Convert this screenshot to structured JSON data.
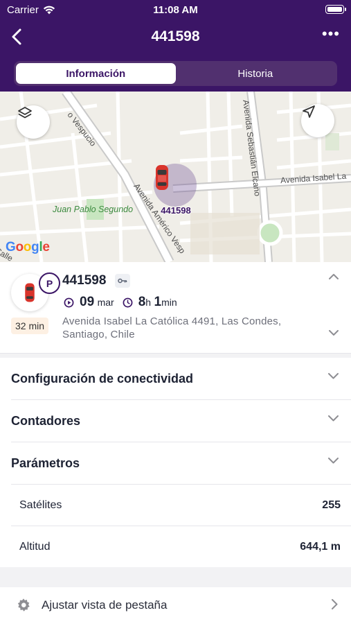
{
  "status_bar": {
    "carrier": "Carrier",
    "time": "11:08 AM",
    "battery_level": 1.0
  },
  "nav": {
    "title": "441598",
    "back_icon": "chevron-left-icon",
    "more_icon": "ellipsis-icon"
  },
  "tabs": [
    {
      "label": "Información",
      "active": true
    },
    {
      "label": "Historia",
      "active": false
    }
  ],
  "map": {
    "roads": {
      "vespucio_top": "o Vespucio",
      "vespucio_mid": "Avenida Américo Vesp",
      "sebastian": "Avenida Sebastián Elcano",
      "isabel": "Avenida Isabel La",
      "calle": "Calle"
    },
    "park": "Juan Pablo Segundo",
    "attribution": "Google",
    "marker_label": "441598",
    "layers_icon": "layers-icon",
    "locate_icon": "navigation-arrow-icon"
  },
  "vehicle": {
    "name": "441598",
    "status_badge": "P",
    "parked_duration": "32 min",
    "date_day": "09",
    "date_month": "mar",
    "duration_h": "8",
    "duration_h_unit": "h",
    "duration_m": "1",
    "duration_m_unit": "min",
    "address": "Avenida Isabel La Católica 4491, Las Condes, Santiago, Chile",
    "colors": {
      "accent": "#3b1566",
      "car": "#d9342b"
    }
  },
  "sections": [
    {
      "title": "Configuración de conectividad"
    },
    {
      "title": "Contadores"
    },
    {
      "title": "Parámetros"
    }
  ],
  "parameters": [
    {
      "label": "Satélites",
      "value": "255"
    },
    {
      "label": "Altitud",
      "value": "644,1 m"
    }
  ],
  "footer": {
    "adjust_label": "Ajustar vista de pestaña",
    "icon": "gear-icon"
  }
}
